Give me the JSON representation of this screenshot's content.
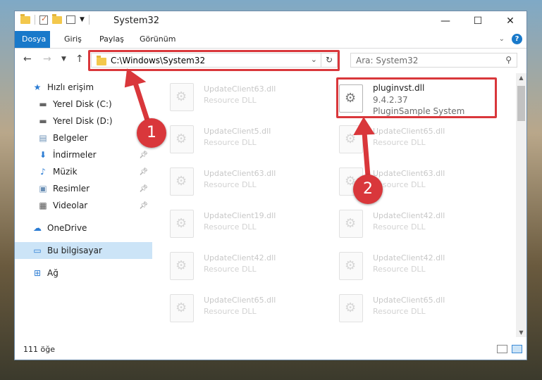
{
  "window": {
    "title": "System32",
    "controls": {
      "minimize": "—",
      "maximize": "☐",
      "close": "✕"
    }
  },
  "ribbon": {
    "tabs": [
      "Dosya",
      "Giriş",
      "Paylaş",
      "Görünüm"
    ],
    "help": "?"
  },
  "address": {
    "path": "C:\\Windows\\System32",
    "search_placeholder": "Ara: System32"
  },
  "nav": {
    "items": [
      {
        "label": "Hızlı erişim",
        "icon": "star-icon"
      },
      {
        "label": "Yerel Disk (C:)",
        "icon": "drive-icon"
      },
      {
        "label": "Yerel Disk (D:)",
        "icon": "drive-icon"
      },
      {
        "label": "Belgeler",
        "icon": "documents-icon"
      },
      {
        "label": "İndirmeler",
        "icon": "download-icon"
      },
      {
        "label": "Müzik",
        "icon": "music-icon"
      },
      {
        "label": "Resimler",
        "icon": "pictures-icon"
      },
      {
        "label": "Videolar",
        "icon": "video-icon"
      },
      {
        "label": "OneDrive",
        "icon": "cloud-icon"
      },
      {
        "label": "Bu bilgisayar",
        "icon": "computer-icon"
      },
      {
        "label": "Ağ",
        "icon": "network-icon"
      }
    ]
  },
  "files": {
    "highlighted": {
      "name": "pluginvst.dll",
      "version": "9.4.2.37",
      "description": "PluginSample System"
    },
    "left_column": [
      {
        "name": "UpdateClient63.dll",
        "desc": "Resource DLL"
      },
      {
        "name": "UpdateClient5.dll",
        "desc": "Resource DLL"
      },
      {
        "name": "UpdateClient63.dll",
        "desc": "Resource DLL"
      },
      {
        "name": "UpdateClient19.dll",
        "desc": "Resource DLL"
      },
      {
        "name": "UpdateClient42.dll",
        "desc": "Resource DLL"
      },
      {
        "name": "UpdateClient65.dll",
        "desc": "Resource DLL"
      }
    ],
    "right_column": [
      {
        "name": "UpdateClient65.dll",
        "desc": "Resource DLL"
      },
      {
        "name": "UpdateClient63.dll",
        "desc": "Resource DLL"
      },
      {
        "name": "UpdateClient42.dll",
        "desc": "Resource DLL"
      },
      {
        "name": "UpdateClient42.dll",
        "desc": "Resource DLL"
      },
      {
        "name": "UpdateClient65.dll",
        "desc": "Resource DLL"
      }
    ]
  },
  "status": {
    "count": "111 öğe"
  },
  "annotations": {
    "step1": "1",
    "step2": "2",
    "color": "#d9373b"
  }
}
